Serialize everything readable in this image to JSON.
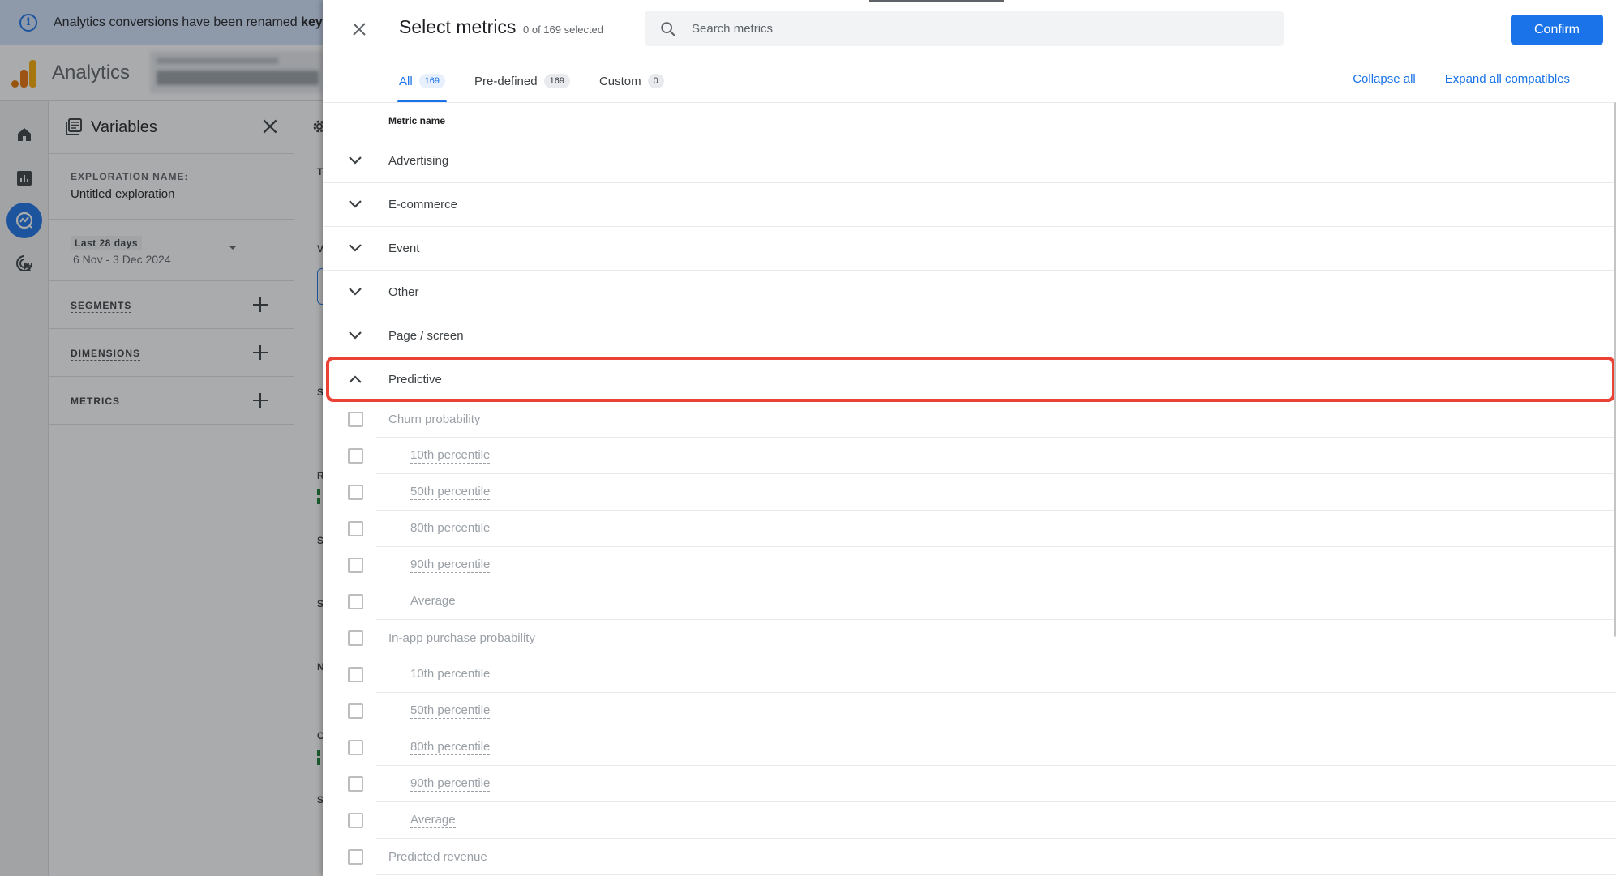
{
  "background": {
    "banner": {
      "text": "Analytics conversions have been renamed ",
      "bold_text": "key"
    },
    "app_name": "Analytics",
    "rail": {
      "items": [
        {
          "name": "home",
          "icon": "home-icon"
        },
        {
          "name": "reports",
          "icon": "bar-chart-icon"
        },
        {
          "name": "explore",
          "icon": "explore-icon",
          "active": true
        },
        {
          "name": "advertising",
          "icon": "target-cursor-icon"
        }
      ]
    },
    "variables_panel": {
      "title": "Variables",
      "exploration_name_label": "EXPLORATION NAME:",
      "exploration_name": "Untitled exploration",
      "date_chip": "Last 28 days",
      "date_range": "6 Nov - 3 Dec 2024",
      "sections": [
        {
          "label": "SEGMENTS"
        },
        {
          "label": "DIMENSIONS"
        },
        {
          "label": "METRICS"
        }
      ]
    },
    "strip_labels": [
      "T",
      "V",
      "S",
      "R",
      "S",
      "S",
      "N",
      "C",
      "S"
    ]
  },
  "dialog": {
    "title": "Select metrics",
    "selection_count": "0 of 169 selected",
    "search": {
      "placeholder": "Search metrics",
      "value": ""
    },
    "confirm_label": "Confirm",
    "tabs": [
      {
        "label": "All",
        "count": "169",
        "active": true
      },
      {
        "label": "Pre-defined",
        "count": "169",
        "active": false
      },
      {
        "label": "Custom",
        "count": "0",
        "active": false
      }
    ],
    "collapse_all_label": "Collapse all",
    "expand_all_label": "Expand all compatibles",
    "column_header": "Metric name",
    "categories": [
      {
        "label": "Advertising",
        "expanded": false
      },
      {
        "label": "E-commerce",
        "expanded": false
      },
      {
        "label": "Event",
        "expanded": false
      },
      {
        "label": "Other",
        "expanded": false
      },
      {
        "label": "Page / screen",
        "expanded": false
      },
      {
        "label": "Predictive",
        "expanded": true,
        "highlighted": true
      }
    ],
    "predictive_metrics": [
      {
        "label": "Churn probability",
        "sub": false,
        "checked": false
      },
      {
        "label": "10th percentile",
        "sub": true,
        "checked": false
      },
      {
        "label": "50th percentile",
        "sub": true,
        "checked": false
      },
      {
        "label": "80th percentile",
        "sub": true,
        "checked": false
      },
      {
        "label": "90th percentile",
        "sub": true,
        "checked": false
      },
      {
        "label": "Average",
        "sub": true,
        "checked": false
      },
      {
        "label": "In-app purchase probability",
        "sub": false,
        "checked": false
      },
      {
        "label": "10th percentile",
        "sub": true,
        "checked": false
      },
      {
        "label": "50th percentile",
        "sub": true,
        "checked": false
      },
      {
        "label": "80th percentile",
        "sub": true,
        "checked": false
      },
      {
        "label": "90th percentile",
        "sub": true,
        "checked": false
      },
      {
        "label": "Average",
        "sub": true,
        "checked": false
      },
      {
        "label": "Predicted revenue",
        "sub": false,
        "checked": false
      }
    ],
    "colors": {
      "accent": "#1a73e8",
      "highlight": "#ea4335"
    }
  }
}
